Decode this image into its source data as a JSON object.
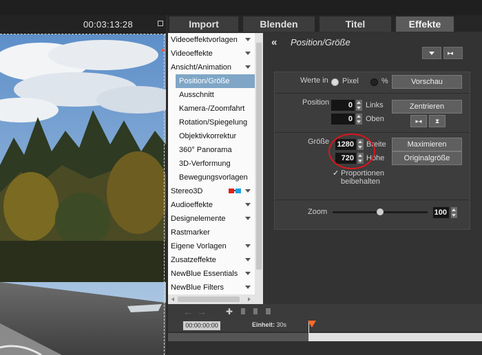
{
  "preview": {
    "timecode": "00:03:13:28"
  },
  "tabs": [
    {
      "label": "Import"
    },
    {
      "label": "Blenden"
    },
    {
      "label": "Titel"
    },
    {
      "label": "Effekte",
      "active": true
    }
  ],
  "categories": [
    {
      "label": "Videoeffektvorlagen",
      "arrow": true
    },
    {
      "label": "Videoeffekte",
      "arrow": true
    },
    {
      "label": "Ansicht/Animation",
      "arrow": true
    },
    {
      "label": "Position/Größe",
      "sub": true,
      "selected": true
    },
    {
      "label": "Ausschnitt",
      "sub": true
    },
    {
      "label": "Kamera-/Zoomfahrt",
      "sub": true
    },
    {
      "label": "Rotation/Spiegelung",
      "sub": true
    },
    {
      "label": "Objektivkorrektur",
      "sub": true
    },
    {
      "label": "360° Panorama",
      "sub": true
    },
    {
      "label": "3D-Verformung",
      "sub": true
    },
    {
      "label": "Bewegungsvorlagen",
      "sub": true
    },
    {
      "label": "Stereo3D",
      "arrow": true,
      "glasses": true
    },
    {
      "label": "Audioeffekte",
      "arrow": true
    },
    {
      "label": "Designelemente",
      "arrow": true
    },
    {
      "label": "Rastmarker"
    },
    {
      "label": "Eigene Vorlagen",
      "arrow": true
    },
    {
      "label": "Zusatzeffekte",
      "arrow": true
    },
    {
      "label": "NewBlue Essentials",
      "arrow": true
    },
    {
      "label": "NewBlue Filters",
      "arrow": true
    }
  ],
  "settings": {
    "title": "Position/Größe",
    "werte_in_label": "Werte in",
    "unit_pixel": "Pixel",
    "unit_percent": "%",
    "selected_unit": "Pixel",
    "vorschau": "Vorschau",
    "position_label": "Position",
    "links_label": "Links",
    "links_value": "0",
    "oben_label": "Oben",
    "oben_value": "0",
    "zentrieren": "Zentrieren",
    "groesse_label": "Größe",
    "breite_label": "Breite",
    "breite_value": "1280",
    "hoehe_label": "Höhe",
    "hoehe_value": "720",
    "maximieren": "Maximieren",
    "originalgroesse": "Originalgröße",
    "proportionen_line1": "Proportionen",
    "proportionen_line2": "beibehalten",
    "proportionen_checked": true,
    "zoom_label": "Zoom",
    "zoom_value": "100",
    "zoom_level": 0.5
  },
  "timeline": {
    "time": "00:00:00:00",
    "unit_label": "Einheit:",
    "unit_value": "30s"
  },
  "colors": {
    "annotation_circle": "#d8161b",
    "selection": "#7fa6c6",
    "playhead": "#ff6a2a"
  }
}
